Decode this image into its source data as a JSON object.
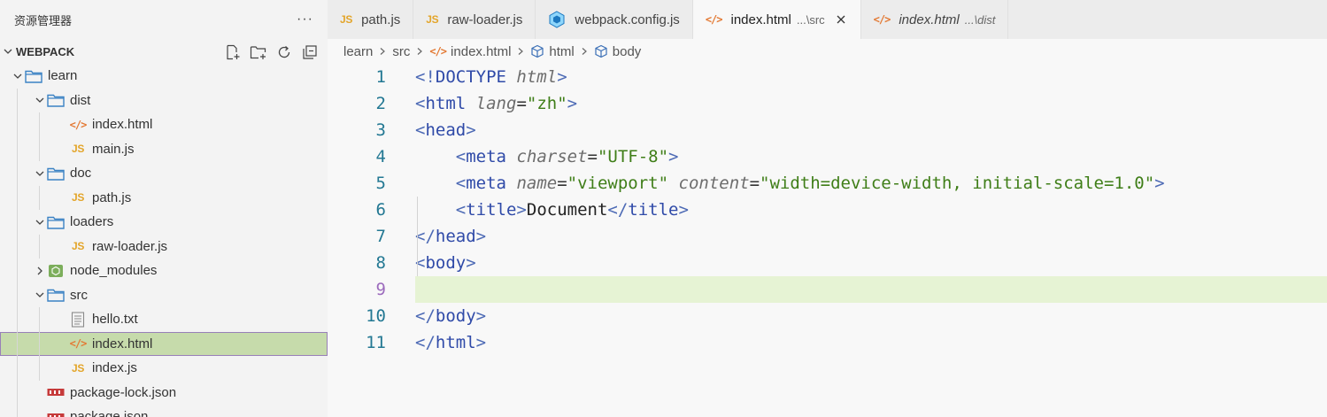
{
  "explorer": {
    "title": "资源管理器",
    "more": "···",
    "section_title": "WEBPACK",
    "actions": [
      "new-file-icon",
      "new-folder-icon",
      "refresh-icon",
      "collapse-all-icon"
    ],
    "tree": [
      {
        "label": "learn",
        "type": "folder",
        "depth": 0,
        "expanded": true
      },
      {
        "label": "dist",
        "type": "folder",
        "depth": 1,
        "expanded": true
      },
      {
        "label": "index.html",
        "type": "html",
        "depth": 2
      },
      {
        "label": "main.js",
        "type": "js",
        "depth": 2
      },
      {
        "label": "doc",
        "type": "folder",
        "depth": 1,
        "expanded": true
      },
      {
        "label": "path.js",
        "type": "js",
        "depth": 2
      },
      {
        "label": "loaders",
        "type": "folder",
        "depth": 1,
        "expanded": true
      },
      {
        "label": "raw-loader.js",
        "type": "js",
        "depth": 2
      },
      {
        "label": "node_modules",
        "type": "node",
        "depth": 1,
        "expanded": false
      },
      {
        "label": "src",
        "type": "folder",
        "depth": 1,
        "expanded": true
      },
      {
        "label": "hello.txt",
        "type": "txt",
        "depth": 2
      },
      {
        "label": "index.html",
        "type": "html",
        "depth": 2,
        "selected": true
      },
      {
        "label": "index.js",
        "type": "js",
        "depth": 2
      },
      {
        "label": "package-lock.json",
        "type": "json",
        "depth": 1
      },
      {
        "label": "package.json",
        "type": "json",
        "depth": 1
      }
    ]
  },
  "tabs": [
    {
      "label": "path.js",
      "type": "js",
      "desc": ""
    },
    {
      "label": "raw-loader.js",
      "type": "js",
      "desc": ""
    },
    {
      "label": "webpack.config.js",
      "type": "webpack",
      "desc": ""
    },
    {
      "label": "index.html",
      "type": "html",
      "desc": "...\\src",
      "active": true
    },
    {
      "label": "index.html",
      "type": "html",
      "desc": "...\\dist",
      "preview": true
    }
  ],
  "breadcrumb": {
    "items": [
      "learn",
      "src",
      "index.html",
      "html",
      "body"
    ]
  },
  "editor": {
    "current_line": 9,
    "lines": [
      {
        "n": "1",
        "text": "<!DOCTYPE html>"
      },
      {
        "n": "2",
        "text": "<html lang=\"zh\">"
      },
      {
        "n": "3",
        "text": "<head>"
      },
      {
        "n": "4",
        "text": "    <meta charset=\"UTF-8\">"
      },
      {
        "n": "5",
        "text": "    <meta name=\"viewport\" content=\"width=device-width, initial-scale=1.0\">"
      },
      {
        "n": "6",
        "text": "    <title>Document</title>"
      },
      {
        "n": "7",
        "text": "</head>"
      },
      {
        "n": "8",
        "text": "<body>"
      },
      {
        "n": "9",
        "text": ""
      },
      {
        "n": "10",
        "text": "</body>"
      },
      {
        "n": "11",
        "text": "</html>"
      }
    ]
  },
  "colors": {
    "js": "#e3a52a",
    "html": "#e37933",
    "folder": "#3b82c4",
    "selection": "#c6dbab",
    "current_line": "#e6f3d4"
  }
}
